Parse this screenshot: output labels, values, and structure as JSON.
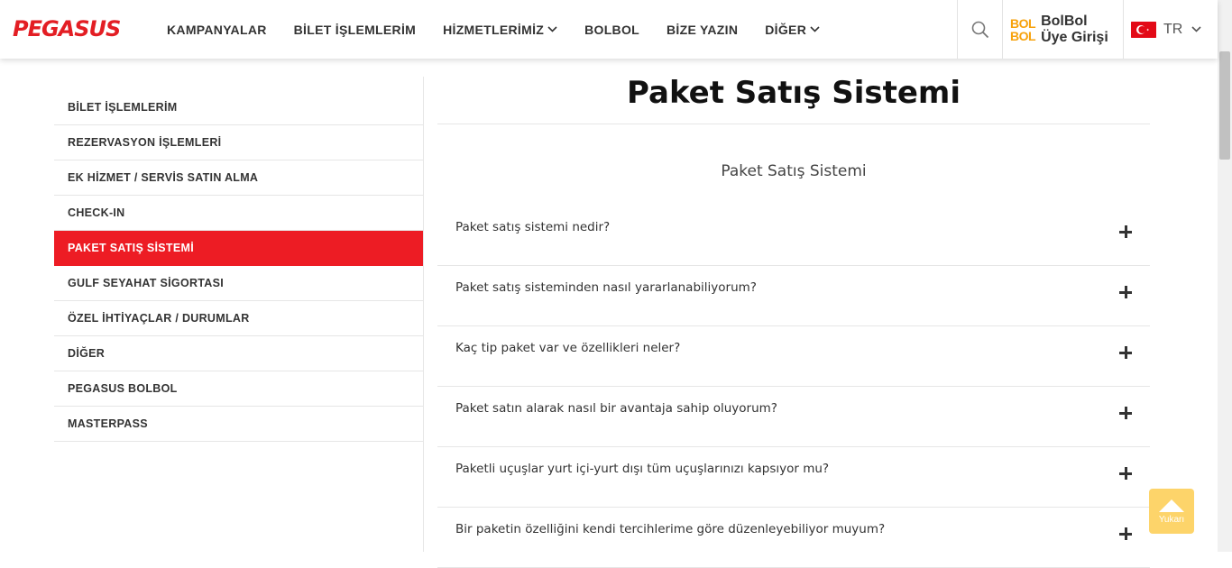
{
  "header": {
    "logo": "PEGASUS",
    "nav": [
      {
        "label": "KAMPANYALAR",
        "has_dropdown": false
      },
      {
        "label": "BİLET İŞLEMLERİM",
        "has_dropdown": false
      },
      {
        "label": "HİZMETLERİMİZ",
        "has_dropdown": true
      },
      {
        "label": "BOLBOL",
        "has_dropdown": false
      },
      {
        "label": "BİZE YAZIN",
        "has_dropdown": false
      },
      {
        "label": "DİĞER",
        "has_dropdown": true
      }
    ],
    "bolbol_mark_top": "BOL",
    "bolbol_mark_bottom": "BOL",
    "bolbol_line1": "BolBol",
    "bolbol_line2": "Üye Girişi",
    "language": "TR"
  },
  "sidebar": {
    "items": [
      {
        "label": "BİLET İŞLEMLERİM",
        "active": false
      },
      {
        "label": "REZERVASYON İŞLEMLERİ",
        "active": false
      },
      {
        "label": "EK HİZMET / SERVİS SATIN ALMA",
        "active": false
      },
      {
        "label": "CHECK-IN",
        "active": false
      },
      {
        "label": "PAKET SATIŞ SİSTEMİ",
        "active": true
      },
      {
        "label": "GULF SEYAHAT SİGORTASI",
        "active": false
      },
      {
        "label": "ÖZEL İHTİYAÇLAR / DURUMLAR",
        "active": false
      },
      {
        "label": "DİĞER",
        "active": false
      },
      {
        "label": "PEGASUS BOLBOL",
        "active": false
      },
      {
        "label": "MASTERPASS",
        "active": false
      }
    ]
  },
  "main": {
    "title": "Paket Satış Sistemi",
    "section_title": "Paket Satış Sistemi",
    "faqs": [
      "Paket satış sistemi nedir?",
      "Paket satış sisteminden nasıl yararlanabiliyorum?",
      "Kaç tip paket var ve özellikleri neler?",
      "Paket satın alarak nasıl bir avantaja sahip oluyorum?",
      "Paketli uçuşlar yurt içi-yurt dışı tüm uçuşlarınızı kapsıyor mu?",
      "Bir paketin özelliğini kendi tercihlerime göre düzenleyebiliyor muyum?"
    ]
  },
  "back_to_top": {
    "label": "Yukarı"
  },
  "colors": {
    "brand_red": "#ed1c24",
    "bolbol_orange": "#f7a20c",
    "up_button": "#fdd46a"
  },
  "icons": {
    "search": "search-icon",
    "chevron": "chevron-down-icon",
    "flag": "turkey-flag-icon",
    "plus": "plus-icon",
    "arrow_up": "arrow-up-icon"
  }
}
